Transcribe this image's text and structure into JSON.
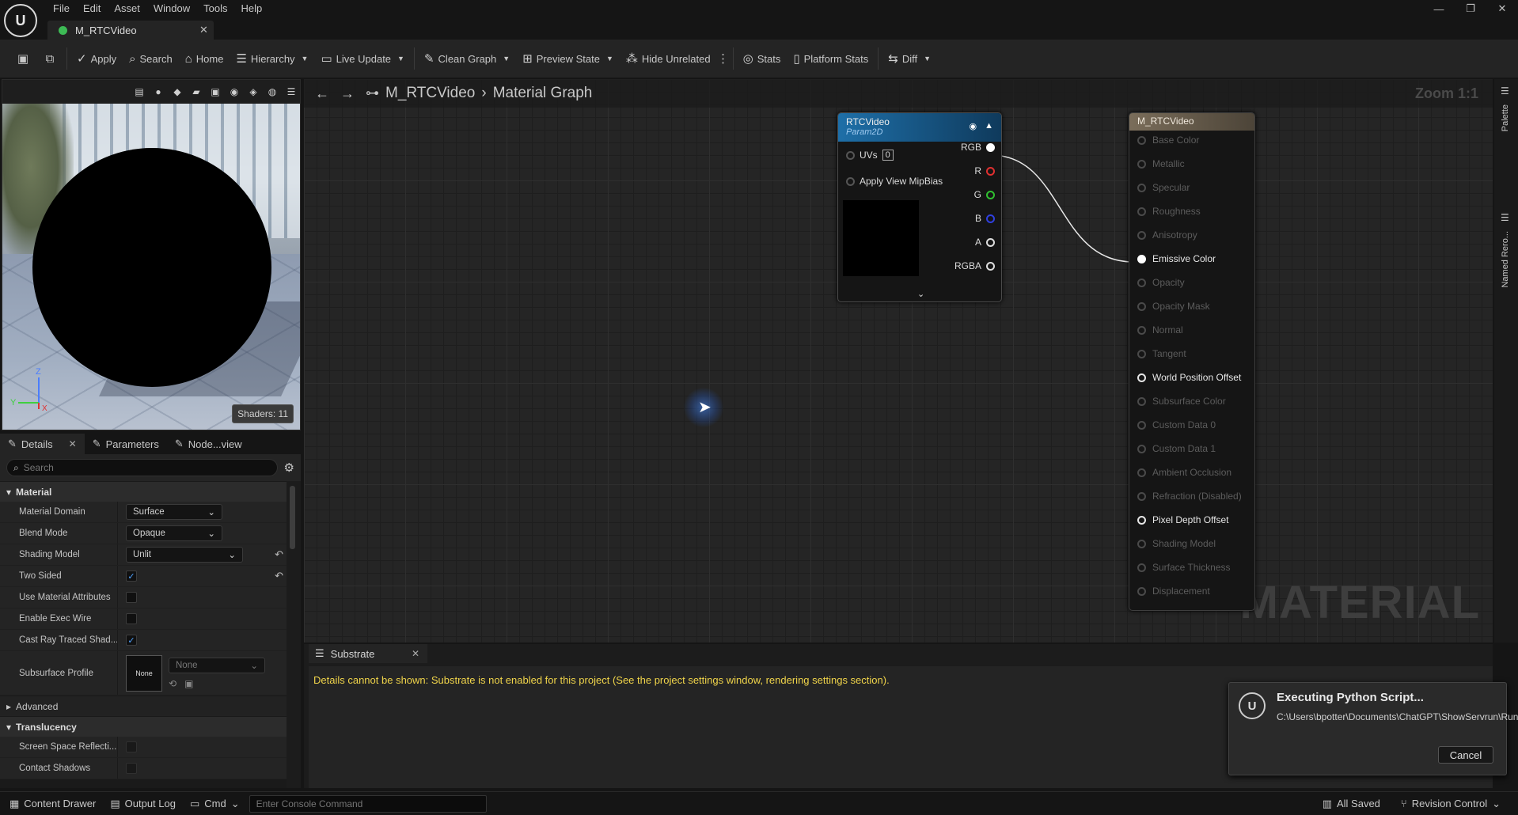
{
  "app": {
    "logo_text": "U",
    "menu": [
      "File",
      "Edit",
      "Asset",
      "Window",
      "Tools",
      "Help"
    ],
    "asset_tab": "M_RTCVideo",
    "window_controls": [
      "—",
      "❐",
      "✕"
    ]
  },
  "toolbar": {
    "apply": "Apply",
    "search": "Search",
    "home": "Home",
    "hierarchy": "Hierarchy",
    "live_update": "Live Update",
    "clean_graph": "Clean Graph",
    "preview_state": "Preview State",
    "hide_unrelated": "Hide Unrelated",
    "stats": "Stats",
    "platform_stats": "Platform Stats",
    "diff": "Diff"
  },
  "viewport": {
    "shaders": "Shaders: 11",
    "axis": {
      "z": "Z",
      "y": "Y",
      "x": "X"
    }
  },
  "details": {
    "tabs": [
      "Details",
      "Parameters",
      "Node...view"
    ],
    "search_placeholder": "Search",
    "material_category": "Material",
    "properties": {
      "material_domain": {
        "label": "Material Domain",
        "value": "Surface"
      },
      "blend_mode": {
        "label": "Blend Mode",
        "value": "Opaque"
      },
      "shading_model": {
        "label": "Shading Model",
        "value": "Unlit"
      },
      "two_sided": {
        "label": "Two Sided",
        "checked": true
      },
      "use_material_attributes": {
        "label": "Use Material Attributes",
        "checked": false
      },
      "enable_exec_wire": {
        "label": "Enable Exec Wire",
        "checked": false
      },
      "cast_ray_traced_shadows": {
        "label": "Cast Ray Traced Shad...",
        "checked": true
      },
      "subsurface_profile": {
        "label": "Subsurface Profile",
        "thumb": "None",
        "value": "None"
      }
    },
    "advanced": "Advanced",
    "translucency_category": "Translucency",
    "translucency": {
      "screen_space_reflections": "Screen Space Reflecti...",
      "contact_shadows": "Contact Shadows"
    }
  },
  "graph": {
    "breadcrumb_asset": "M_RTCVideo",
    "breadcrumb_graph": "Material Graph",
    "zoom": "Zoom 1:1",
    "watermark": "MATERIAL",
    "texture_node": {
      "title": "RTCVideo",
      "subtitle": "Param2D",
      "uvs_label": "UVs",
      "uvs_value": "0",
      "mip_label": "Apply View MipBias",
      "outputs": [
        {
          "label": "RGB",
          "color": "#ffffff"
        },
        {
          "label": "R",
          "color": "#e03030"
        },
        {
          "label": "G",
          "color": "#30c030"
        },
        {
          "label": "B",
          "color": "#3040e0"
        },
        {
          "label": "A",
          "color": "#dddddd"
        },
        {
          "label": "RGBA",
          "color": "#dddddd"
        }
      ]
    },
    "material_node": {
      "title": "M_RTCVideo",
      "inputs": [
        {
          "label": "Base Color",
          "state": "dim"
        },
        {
          "label": "Metallic",
          "state": "dim"
        },
        {
          "label": "Specular",
          "state": "dim"
        },
        {
          "label": "Roughness",
          "state": "dim"
        },
        {
          "label": "Anisotropy",
          "state": "dim"
        },
        {
          "label": "Emissive Color",
          "state": "connected"
        },
        {
          "label": "Opacity",
          "state": "dim"
        },
        {
          "label": "Opacity Mask",
          "state": "dim"
        },
        {
          "label": "Normal",
          "state": "dim"
        },
        {
          "label": "Tangent",
          "state": "dim"
        },
        {
          "label": "World Position Offset",
          "state": "active"
        },
        {
          "label": "Subsurface Color",
          "state": "dim"
        },
        {
          "label": "Custom Data 0",
          "state": "dim"
        },
        {
          "label": "Custom Data 1",
          "state": "dim"
        },
        {
          "label": "Ambient Occlusion",
          "state": "dim"
        },
        {
          "label": "Refraction (Disabled)",
          "state": "dim"
        },
        {
          "label": "Pixel Depth Offset",
          "state": "active"
        },
        {
          "label": "Shading Model",
          "state": "dim"
        },
        {
          "label": "Surface Thickness",
          "state": "dim"
        },
        {
          "label": "Displacement",
          "state": "dim"
        }
      ]
    }
  },
  "substrate": {
    "tab": "Substrate",
    "message": "Details cannot be shown: Substrate is not enabled for this project (See the project settings window, rendering settings section)."
  },
  "right_dock": {
    "palette": "Palette",
    "named_reroutes": "Named Rero..."
  },
  "notification": {
    "title": "Executing Python Script...",
    "path": "C:\\Users\\bpotter\\Documents\\ChatGPT\\ShowServrun\\RunCineStudio.py",
    "cancel": "Cancel"
  },
  "statusbar": {
    "content_drawer": "Content Drawer",
    "output_log": "Output Log",
    "cmd": "Cmd",
    "console_placeholder": "Enter Console Command",
    "all_saved": "All Saved",
    "revision_control": "Revision Control"
  }
}
